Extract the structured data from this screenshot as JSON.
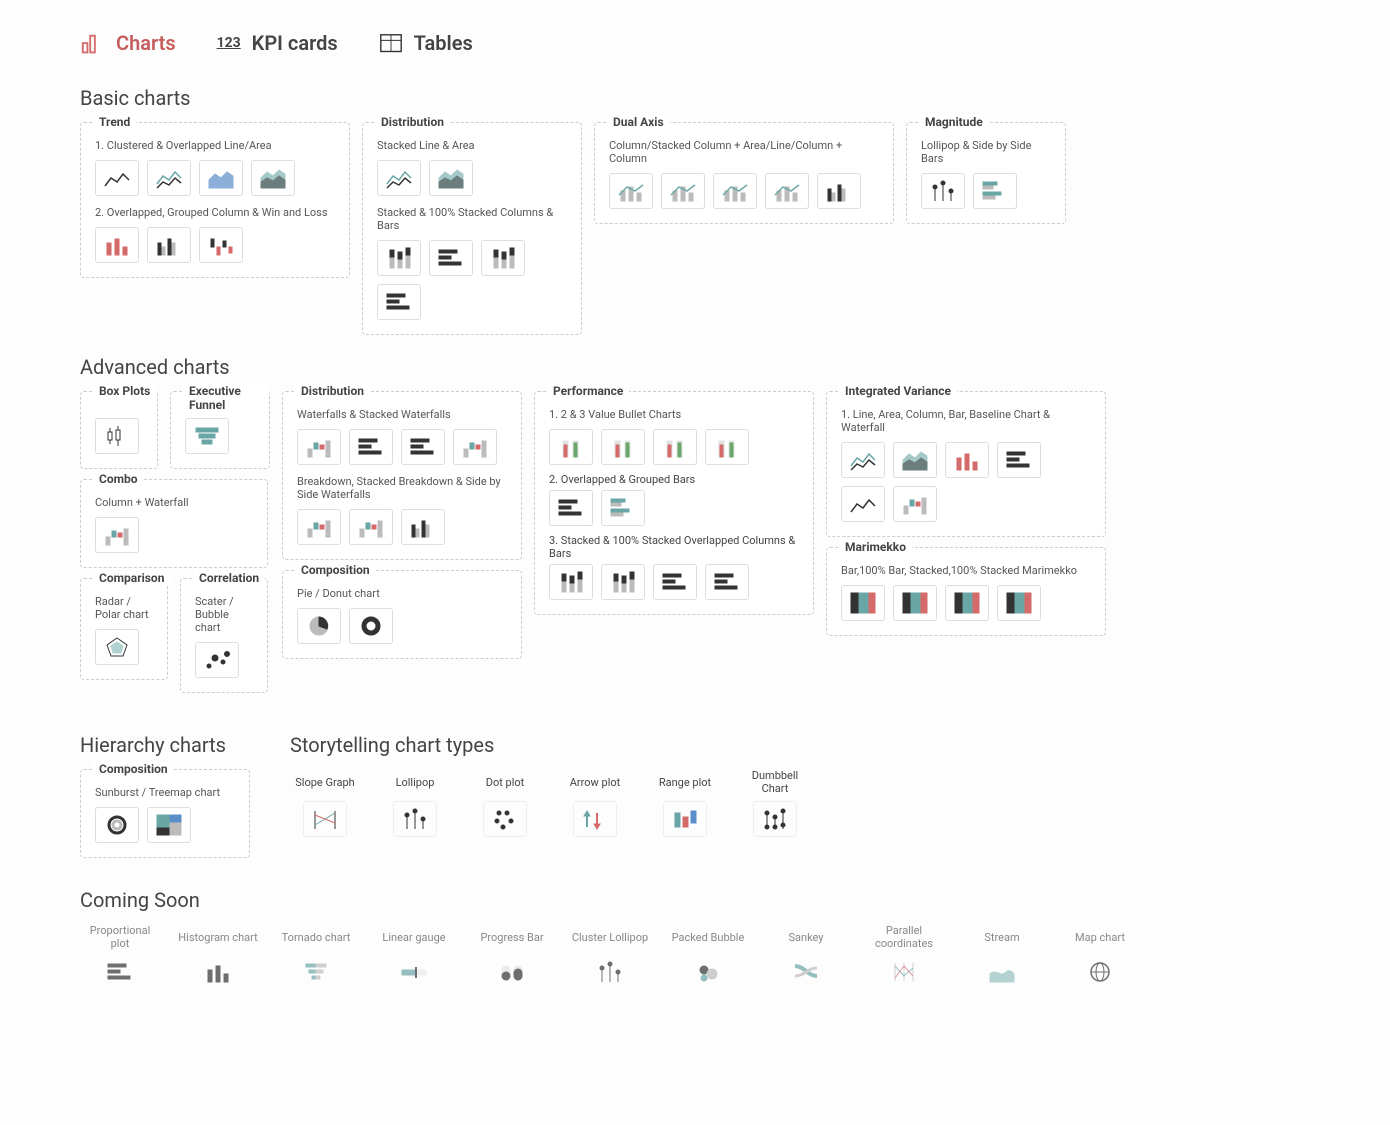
{
  "tabs": {
    "charts": "Charts",
    "kpi": "KPI cards",
    "tables": "Tables"
  },
  "sections": {
    "basic": "Basic charts",
    "advanced": "Advanced charts",
    "hierarchy": "Hierarchy charts",
    "storytelling": "Storytelling chart types",
    "coming": "Coming Soon"
  },
  "basic": {
    "trend": {
      "title": "Trend",
      "sub1": "1. Clustered & Overlapped Line/Area",
      "sub2": "2. Overlapped, Grouped Column & Win and Loss"
    },
    "distribution": {
      "title": "Distribution",
      "sub1": "Stacked Line & Area",
      "sub2": "Stacked & 100% Stacked Columns & Bars"
    },
    "dualaxis": {
      "title": "Dual Axis",
      "sub1": "Column/Stacked Column + Area/Line/Column + Column"
    },
    "magnitude": {
      "title": "Magnitude",
      "sub1": "Lollipop & Side by Side Bars"
    }
  },
  "advanced": {
    "boxplots": {
      "title": "Box Plots"
    },
    "funnel": {
      "title": "Executive Funnel"
    },
    "combo": {
      "title": "Combo",
      "sub1": "Column + Waterfall"
    },
    "comparison": {
      "title": "Comparison",
      "sub1": "Radar / Polar chart"
    },
    "correlation": {
      "title": "Correlation",
      "sub1": "Scater / Bubble chart"
    },
    "distribution": {
      "title": "Distribution",
      "sub1": "Waterfalls & Stacked Waterfalls",
      "sub2": "Breakdown, Stacked Breakdown & Side by Side Waterfalls"
    },
    "composition": {
      "title": "Composition",
      "sub1": "Pie / Donut chart"
    },
    "performance": {
      "title": "Performance",
      "sub1": "1. 2 & 3 Value Bullet Charts",
      "sub2": "2. Overlapped & Grouped Bars",
      "sub3": "3. Stacked & 100% Stacked Overlapped Columns & Bars"
    },
    "variance": {
      "title": "Integrated Variance",
      "sub1": "1. Line, Area, Column, Bar, Baseline Chart & Waterfall"
    },
    "marimekko": {
      "title": "Marimekko",
      "sub1": "Bar,100% Bar, Stacked,100% Stacked Marimekko"
    }
  },
  "hierarchy": {
    "composition": {
      "title": "Composition",
      "sub1": "Sunburst / Treemap chart"
    }
  },
  "storytelling": {
    "items": [
      {
        "label": "Slope Graph"
      },
      {
        "label": "Lollipop"
      },
      {
        "label": "Dot plot"
      },
      {
        "label": "Arrow plot"
      },
      {
        "label": "Range plot"
      },
      {
        "label": "Dumbbell Chart"
      }
    ]
  },
  "coming": {
    "items": [
      {
        "label": "Proportional plot"
      },
      {
        "label": "Histogram chart"
      },
      {
        "label": "Tornado chart"
      },
      {
        "label": "Linear gauge"
      },
      {
        "label": "Progress Bar"
      },
      {
        "label": "Cluster Lollipop"
      },
      {
        "label": "Packed Bubble"
      },
      {
        "label": "Sankey"
      },
      {
        "label": "Parallel coordinates"
      },
      {
        "label": "Stream"
      },
      {
        "label": "Map chart"
      }
    ]
  }
}
